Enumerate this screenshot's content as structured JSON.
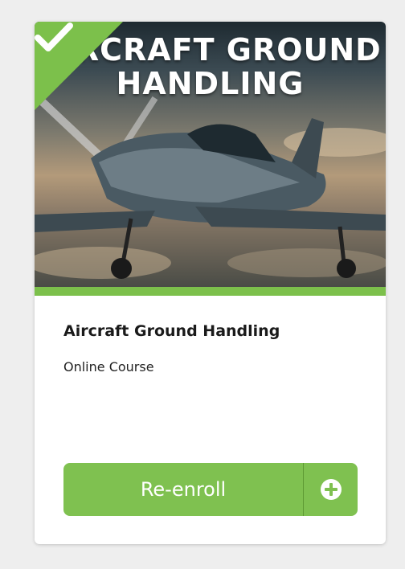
{
  "card": {
    "thumbnail_title_line1": "AIRCRAFT GROUND",
    "thumbnail_title_line2": "HANDLING",
    "thumbnail_icon": "airplane-photo",
    "completed_icon": "check-icon",
    "title": "Aircraft Ground Handling",
    "type": "Online Course",
    "enroll_label": "Re-enroll",
    "add_icon": "plus-circle-icon",
    "accent_color": "#7cc04b"
  }
}
